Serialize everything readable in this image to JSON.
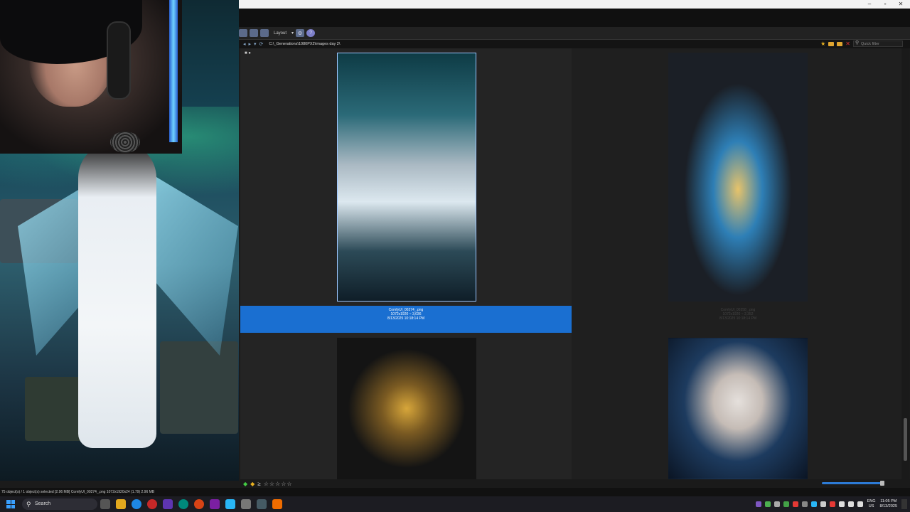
{
  "toolbar": {
    "layout_label": "Layout"
  },
  "address": {
    "path": "C:\\_Generations\\1080PX2\\images day 2\\",
    "filter_placeholder": "Quick filter"
  },
  "thumbnails": [
    {
      "name": "ComfyUI_00274_.png",
      "dims": "1072x1920 ~ 3,036",
      "date": "8/13/2025 10:18:14 PM",
      "selected": true
    },
    {
      "name": "ComfyUI_00258_.png",
      "dims": "1072x1920 ~ 2,352",
      "date": "8/13/2025 10:18:14 PM",
      "selected": false
    },
    {
      "name": "",
      "dims": "",
      "date": "",
      "selected": false
    },
    {
      "name": "",
      "dims": "",
      "date": "",
      "selected": false
    }
  ],
  "rating": {
    "stars": "☆☆☆☆☆",
    "value": 0
  },
  "status": {
    "text": "75 object(s) / 1 object(s) selected [2.96 MB]   ComfyUI_00274_.png   1072x1920x24 (1.79)   2.96 MB"
  },
  "taskbar": {
    "search_label": "Search",
    "lang_top": "ENG",
    "lang_bottom": "US",
    "time": "11:05 PM",
    "date": "8/13/2025"
  },
  "colors": {
    "selection": "#1a6fd1",
    "accent": "#3aa0ff"
  }
}
